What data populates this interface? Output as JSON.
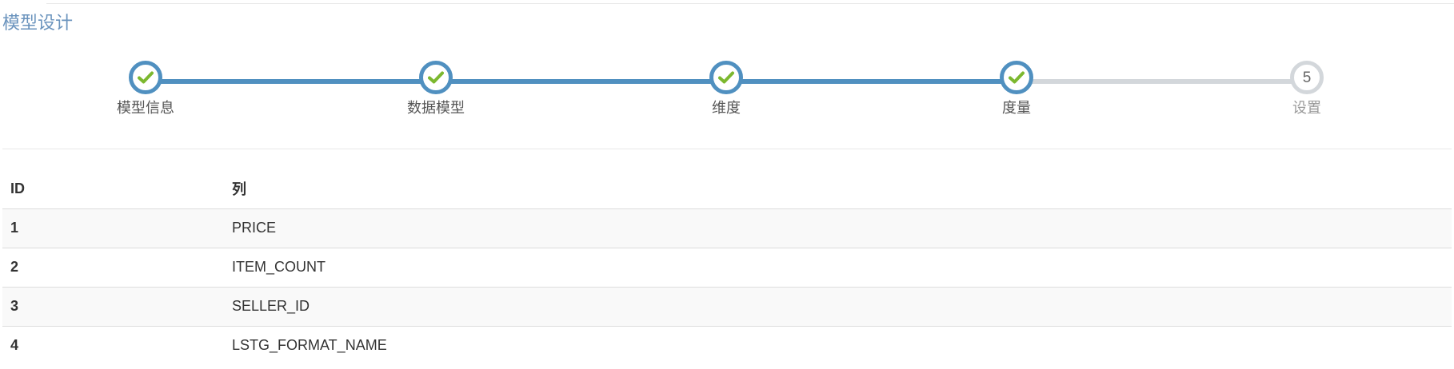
{
  "page": {
    "title": "模型设计"
  },
  "stepper": {
    "progress_fraction": 0.75,
    "steps": [
      {
        "label": "模型信息",
        "status": "done",
        "icon": "check-icon"
      },
      {
        "label": "数据模型",
        "status": "done",
        "icon": "check-icon"
      },
      {
        "label": "维度",
        "status": "done",
        "icon": "check-icon"
      },
      {
        "label": "度量",
        "status": "done",
        "icon": "check-icon"
      },
      {
        "label": "设置",
        "status": "pending",
        "number": "5"
      }
    ]
  },
  "table": {
    "headers": {
      "id": "ID",
      "column": "列"
    },
    "rows": [
      {
        "id": "1",
        "column": "PRICE"
      },
      {
        "id": "2",
        "column": "ITEM_COUNT"
      },
      {
        "id": "3",
        "column": "SELLER_ID"
      },
      {
        "id": "4",
        "column": "LSTG_FORMAT_NAME"
      }
    ]
  },
  "colors": {
    "accent": "#5090c0",
    "check": "#7cb82f",
    "pending": "#d3d7db",
    "title": "#6a93bd"
  }
}
